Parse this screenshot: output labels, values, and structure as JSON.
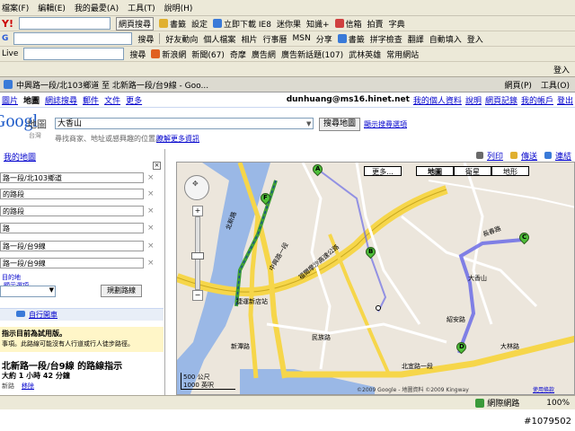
{
  "menu": [
    "檔案(F)",
    "編輯(E)",
    "我的最愛(A)",
    "工具(T)",
    "說明(H)"
  ],
  "toolbar1": {
    "brand": "Y!",
    "search_button": "網頁搜尋",
    "items": [
      "書籤",
      "設定",
      "立即下載 IE8",
      "迷你果",
      "知識+",
      "信箱",
      "拍賣",
      "字典"
    ]
  },
  "toolbar2": {
    "items": [
      "搜尋",
      "好友動向",
      "個人檔案",
      "相片",
      "行事曆",
      "MSN",
      "分享",
      "書籤",
      "拼字檢查",
      "翻譯",
      "自動填入",
      "登入"
    ]
  },
  "toolbar3": {
    "label": "Live",
    "search": "搜尋",
    "items": [
      "新浪網",
      "新聞(67)",
      "奇摩",
      "廣告網",
      "廣告新話題(107)",
      "武林英雄",
      "常用網站"
    ],
    "login": "登入"
  },
  "tab": {
    "title": "中興路一段/北103鄉道 至 北新路一段/台9線 - Goo...",
    "home": "網頁(P)",
    "tools": "工具(O)"
  },
  "gtop": {
    "links": [
      "圖片",
      "地圖",
      "網誌搜尋",
      "郵件",
      "文件",
      "更多"
    ],
    "user": "dunhuang@ms16.hinet.net",
    "user_links": [
      "我的個人資料",
      "說明",
      "網頁記錄",
      "我的帳戶",
      "登出"
    ]
  },
  "search": {
    "logo": "Google",
    "product": "地圖",
    "region": "台灣",
    "value": "大香山",
    "button": "搜尋地圖",
    "options_link": "顯示搜尋選項",
    "hint": "尋找商家、地址或感興趣的位置。",
    "more_link": "瞭解更多資訊"
  },
  "map_links": {
    "print": "列印",
    "send": "傳送",
    "link": "連結"
  },
  "sidebar": {
    "my_maps": "我的地圖",
    "fields": [
      "路一段/北103鄉道",
      "的路段",
      "的路段",
      "路",
      "路一段/台9線",
      "路一段/台9線"
    ],
    "add_dest": "目的地",
    "options": "顯示選項",
    "route_button": "規劃路線",
    "mode_link": "自行開車",
    "beta_title": "指示目前為試用版。",
    "beta_text": "事項。此路線可能沒有人行道或行人徒步路徑。",
    "route_title": "北新路一段/台9線 的路線指示",
    "route_time": "大約 1 小時 42 分鐘",
    "via": "新路",
    "remove": "移除"
  },
  "map": {
    "types": [
      "更多...",
      "地圖",
      "衛星",
      "地形"
    ],
    "labels": [
      "捷運新店站",
      "長春路",
      "大香山",
      "中興路一段",
      "福爾摩沙高速公路",
      "北新路",
      "北宜路一段",
      "大林路",
      "紹安路",
      "新潭路",
      "民族路"
    ],
    "scale_m": "500 公尺",
    "scale_ft": "1000 英呎",
    "copyright": "©2009 Google - 地圖資料 ©2009 Kingway",
    "terms": "使用條款",
    "markers": [
      "A",
      "B",
      "C",
      "D",
      "F"
    ]
  },
  "status": {
    "zone": "網際網路",
    "zoom": "100%"
  },
  "watermark": "#1079502"
}
